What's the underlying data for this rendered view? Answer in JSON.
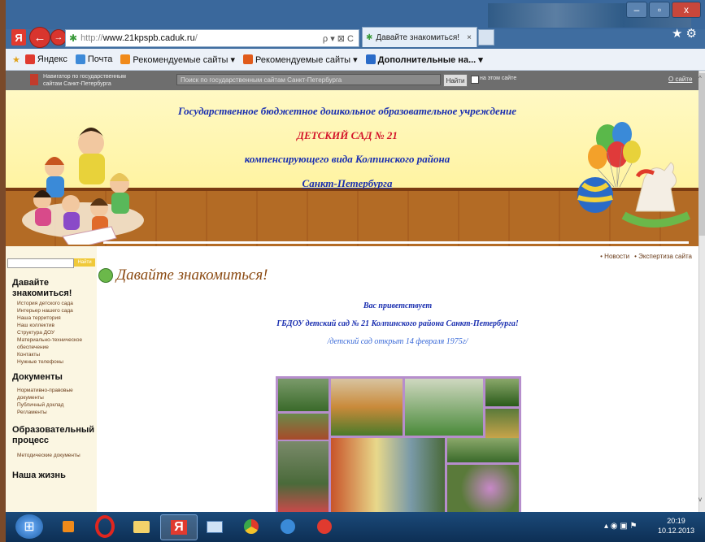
{
  "browser": {
    "url_prefix": "http://",
    "url_domain": "www.21kpspb.caduk.ru",
    "url_suffix": "/",
    "tab_title": "Давайте знакомиться!",
    "tab_close": "×",
    "search_icons": "ρ ▾ ⊠ C",
    "window_controls": {
      "minimize": "–",
      "maximize": "▫",
      "close": "x"
    }
  },
  "favorites": [
    {
      "label": "Яндекс",
      "color": "#e03a2f"
    },
    {
      "label": "Почта",
      "color": "#3d8ad8"
    },
    {
      "label": "Рекомендуемые сайты ▾",
      "color": "#f08a1a"
    },
    {
      "label": "Рекомендуемые сайты ▾",
      "color": "#e05a1a"
    },
    {
      "label": "Дополнительные на...  ▾",
      "color": "#2a6bc8"
    }
  ],
  "govbar": {
    "navigator_line1": "Навигатор по государственным",
    "navigator_line2": "сайтам Санкт-Петербурга",
    "search_placeholder": "Поиск по государственным сайтам Санкт-Петербурга",
    "find_button": "Найти",
    "checkbox_label": "на этом сайте",
    "about_link": "О сайте"
  },
  "header": {
    "line1": "Государственное бюджетное дошкольное образовательное учреждение",
    "line2": "ДЕТСКИЙ САД № 21",
    "line3": "компенсирующего вида Колпинского района",
    "line4": "Санкт-Петербурга"
  },
  "sidebar": {
    "search_button": "Найти",
    "section1_title": "Давайте знакомиться!",
    "section1_links": [
      "История детского сада",
      "Интерьер нашего сада",
      "Наша территория",
      "Наш коллектив",
      "Структура ДОУ",
      "Материально-техническое обеспечение",
      "Контакты",
      "Нужные телефоны"
    ],
    "section2_title": "Документы",
    "section2_links": [
      "Нормативно-правовые документы",
      "Публичный доклад",
      "Регламенты"
    ],
    "section3_title": "Образовательный процесс",
    "section3_links": [
      "Методические документы"
    ],
    "section4_title": "Наша жизнь"
  },
  "content": {
    "top_links": [
      "• Новости",
      "• Экспертиза сайта"
    ],
    "page_title": "Давайте знакомиться!",
    "greeting1": "Вас приветствует",
    "greeting2": "ГБДОУ детский сад № 21 Колпинского района Санкт-Петербурга!",
    "greeting3": "/детский сад открыт 14 февраля 1975г/"
  },
  "taskbar": {
    "time": "20:19",
    "date": "10.12.2013"
  },
  "colors": {
    "header_text_blue": "#1a2fb0",
    "header_text_red": "#d4152b",
    "sidebar_title": "#111111",
    "link_brown": "#6a3c1a",
    "page_title_brown": "#8b4a12"
  }
}
